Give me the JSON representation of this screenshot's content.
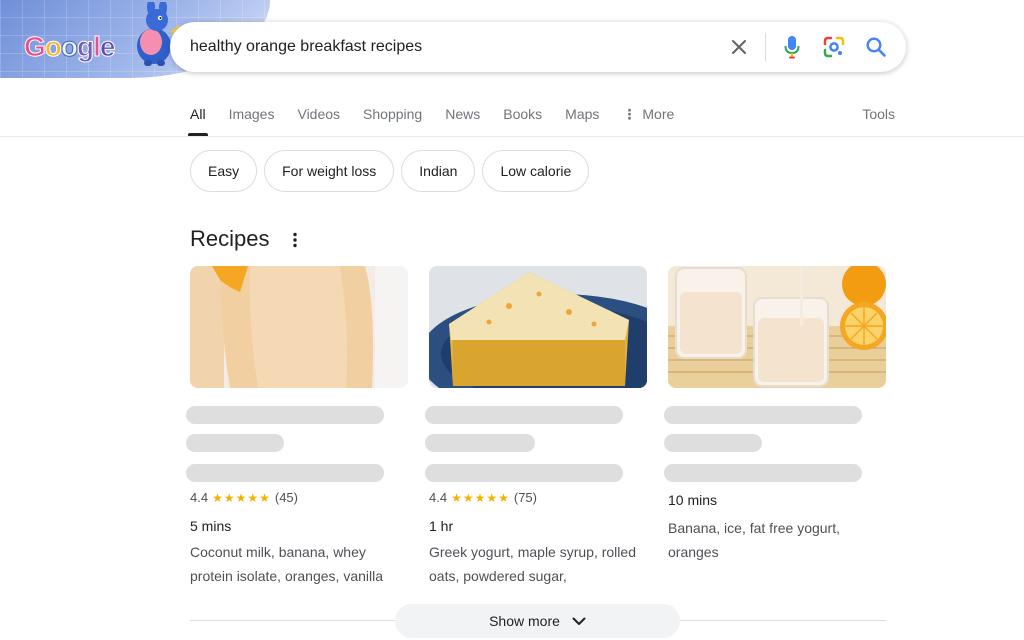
{
  "search": {
    "query": "healthy orange breakfast recipes"
  },
  "logo": {
    "letters": [
      "G",
      "o",
      "o",
      "g",
      "l",
      "e"
    ]
  },
  "icons": {
    "clear": "close-icon",
    "voice": "microphone-icon",
    "lens": "camera-lens-icon",
    "search": "search-icon",
    "more": "more-vert-icon",
    "chevron": "chevron-down-icon"
  },
  "tabs": [
    {
      "label": "All",
      "active": true
    },
    {
      "label": "Images"
    },
    {
      "label": "Videos"
    },
    {
      "label": "Shopping"
    },
    {
      "label": "News"
    },
    {
      "label": "Books"
    },
    {
      "label": "Maps"
    }
  ],
  "more_tab": {
    "dots": "⋮",
    "label": "More"
  },
  "tools_label": "Tools",
  "chips": [
    "Easy",
    "For weight loss",
    "Indian",
    "Low calorie"
  ],
  "recipes": {
    "title": "Recipes",
    "cards": [
      {
        "image": "orange-smoothie-glass",
        "rating": "4.4",
        "stars": "★★★★★",
        "reviews": "(45)",
        "time": "5 mins",
        "ingredients": "Coconut milk, banana, whey protein isolate, oranges, vanilla"
      },
      {
        "image": "orange-cake-slice",
        "rating": "4.4",
        "stars": "★★★★★",
        "reviews": "(75)",
        "time": "1 hr",
        "ingredients": "Greek yogurt, maple syrup, rolled oats, powdered sugar,"
      },
      {
        "image": "orange-smoothie-glasses-with-oranges",
        "time": "10 mins",
        "ingredients": "Banana, ice, fat free yogurt, oranges"
      }
    ]
  },
  "show_more": "Show more",
  "colors": {
    "accent_blue": "#4285f4",
    "star_gold": "#f0b400",
    "skeleton_gray": "#dedede"
  }
}
